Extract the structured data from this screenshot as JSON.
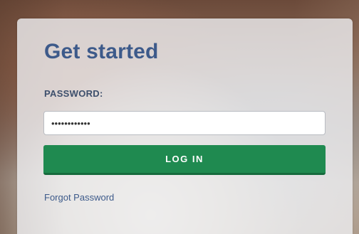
{
  "form": {
    "title": "Get started",
    "password_label": "PASSWORD:",
    "password_value": "............",
    "login_button_label": "LOG IN",
    "forgot_link_label": "Forgot Password"
  },
  "colors": {
    "title": "#3d5a8a",
    "button": "#1f8a50",
    "link": "#3d5a8a"
  }
}
